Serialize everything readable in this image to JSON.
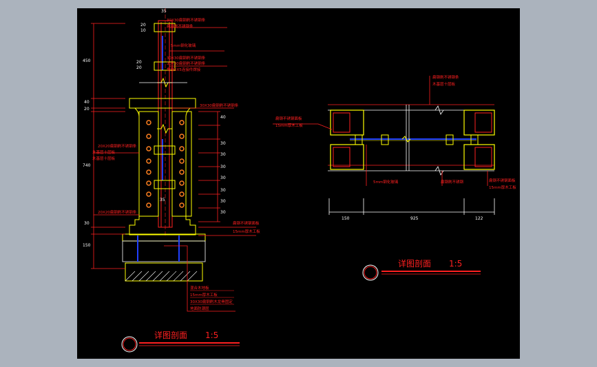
{
  "colors": {
    "background": "#abb3bd",
    "canvas": "#000000",
    "red": "#ff2020",
    "yellow": "#ffff00",
    "blue": "#2040ff",
    "white": "#ffffff",
    "orange": "#ff8020"
  },
  "left": {
    "title": "详图剖面",
    "scale": "1:5",
    "dims_top": [
      "35"
    ],
    "dims_left": [
      "450",
      "40",
      "20",
      "740",
      "30",
      "150"
    ],
    "dims_right": [
      "40",
      "30",
      "30",
      "30",
      "30",
      "30",
      "30",
      "30"
    ],
    "dims_small": [
      "20",
      "10",
      "20",
      "20",
      "35"
    ],
    "labels": {
      "l1": "30X30扁钢刷不锈钢条",
      "l2": "扁钢刷不锈钢条",
      "l3": "5mm钢化玻璃",
      "l4": "30X30扁钢刷不锈钢条",
      "l5": "30X30扁钢刷不锈钢条",
      "l6": "角钢5X5连接件焊接",
      "l7": "30X30扁钢刷不锈钢条",
      "l8": "20X20扁钢刷不锈钢条",
      "l9": "木基层十层板",
      "l10": "木基层十层板",
      "l11": "20X20扁钢刷不锈钢条",
      "l12": "扁钢不锈钢面板",
      "l13": "15mm厚木工板",
      "l14": "混合木地板",
      "l15": "15mm厚木工板",
      "l16": "30X30扁钢刷木龙骨固定",
      "l17": "地面防潮层"
    }
  },
  "right": {
    "title": "详图剖面",
    "scale": "1:5",
    "dims": [
      "150",
      "925",
      "122"
    ],
    "labels": {
      "r1": "扁钢刷不锈钢条",
      "r2": "木基层十层板",
      "r3": "扁钢不锈钢面板",
      "r4": "15mm厚木工板",
      "r5": "5mm钢化玻璃",
      "r6": "扁钢刷不锈钢",
      "r7": "扁钢不锈钢面板",
      "r8": "15mm厚木工板"
    }
  }
}
